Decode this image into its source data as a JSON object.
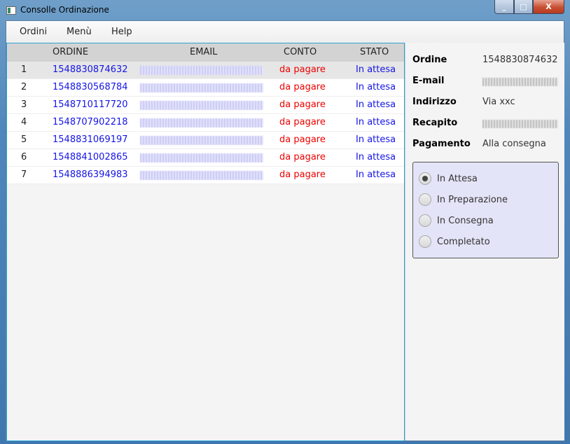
{
  "window": {
    "title": "Consolle Ordinazione",
    "minimize": "_",
    "maximize": "□",
    "close": "X"
  },
  "menu": [
    "Ordini",
    "Menù",
    "Help"
  ],
  "table": {
    "headers": {
      "ordine": "ORDINE",
      "email": "EMAIL",
      "conto": "CONTO",
      "stato": "STATO"
    },
    "rows": [
      {
        "n": "1",
        "ordine": "1548830874632",
        "conto": "da pagare",
        "stato": "In attesa"
      },
      {
        "n": "2",
        "ordine": "1548830568784",
        "conto": "da pagare",
        "stato": "In attesa"
      },
      {
        "n": "3",
        "ordine": "1548710117720",
        "conto": "da pagare",
        "stato": "In attesa"
      },
      {
        "n": "4",
        "ordine": "1548707902218",
        "conto": "da pagare",
        "stato": "In attesa"
      },
      {
        "n": "5",
        "ordine": "1548831069197",
        "conto": "da pagare",
        "stato": "In attesa"
      },
      {
        "n": "6",
        "ordine": "1548841002865",
        "conto": "da pagare",
        "stato": "In attesa"
      },
      {
        "n": "7",
        "ordine": "1548886394983",
        "conto": "da pagare",
        "stato": "In attesa"
      }
    ],
    "selected_row": 0
  },
  "details": {
    "ordine_label": "Ordine",
    "ordine": "1548830874632",
    "email_label": "E-mail",
    "indirizzo_label": "Indirizzo",
    "indirizzo": "Via xxc",
    "recapito_label": "Recapito",
    "pagamento_label": "Pagamento",
    "pagamento": "Alla consegna"
  },
  "status_options": [
    "In Attesa",
    "In Preparazione",
    "In Consegna",
    "Completato"
  ],
  "status_selected": 0,
  "colors": {
    "link": "#1515e6",
    "unpaid": "#ee0000",
    "focus_border": "#29a3d6",
    "radio_panel": "#e4e4f8"
  }
}
